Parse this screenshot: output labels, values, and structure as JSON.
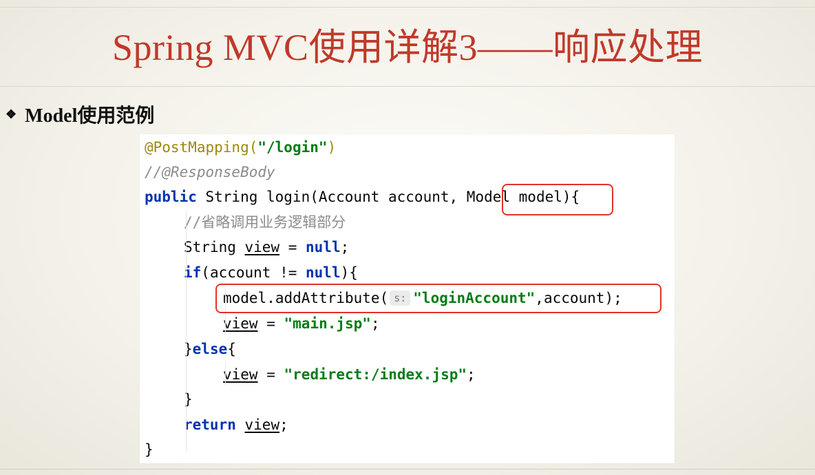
{
  "slide": {
    "title": "Spring MVC使用详解3——响应处理",
    "section": {
      "bullet": "❖",
      "heading": "Model使用范例"
    }
  },
  "code": {
    "line1": {
      "annotation": "@PostMapping(",
      "string": "\"/login\"",
      "close": ")"
    },
    "line2": {
      "comment": "//@ResponseBody"
    },
    "line3": {
      "keyword": "public",
      "text": " String login(Account account, ",
      "highlight": "Model model",
      "close": "){"
    },
    "line4": {
      "comment": "//省略调用业务逻辑部分"
    },
    "line5": {
      "text": "String ",
      "var": "view",
      "assign": " = ",
      "keyword": "null",
      "end": ";"
    },
    "line6": {
      "keyword": "if",
      "text": "(account != ",
      "keyword2": "null",
      "end": "){"
    },
    "line7": {
      "text": "model.addAttribute(",
      "hint": "s:",
      "string": "\"loginAccount\"",
      "rest": ",account)",
      "end": ";"
    },
    "line8": {
      "var": "view",
      "assign": " = ",
      "string": "\"main.jsp\"",
      "end": ";"
    },
    "line9": {
      "brace": "}",
      "keyword": "else",
      "end": "{"
    },
    "line10": {
      "var": "view",
      "assign": " = ",
      "string": "\"redirect:/index.jsp\"",
      "end": ";"
    },
    "line11": {
      "brace": "}"
    },
    "line12": {
      "keyword": "return",
      "space": " ",
      "var": "view",
      "end": ";"
    },
    "line13": {
      "brace": "}"
    }
  },
  "colors": {
    "title": "#c0392b",
    "highlight_border": "#e0312a",
    "keyword": "#0033b3",
    "string": "#067d17",
    "annotation": "#9e880d",
    "comment": "#8c8c8c"
  }
}
